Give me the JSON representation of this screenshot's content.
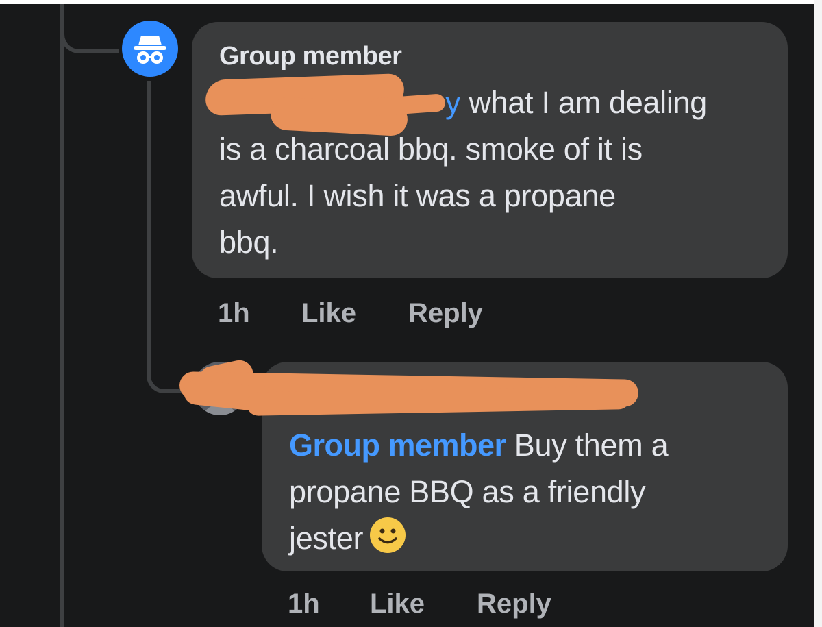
{
  "comment": {
    "author": "Group member",
    "mention_tail": "y ",
    "text_line1": "what I am dealing",
    "text_line2": "is a charcoal bbq. smoke of it is",
    "text_line3": "awful. I wish it was a propane",
    "text_line4": "bbq.",
    "time": "1h",
    "like_label": "Like",
    "reply_label": "Reply"
  },
  "reply": {
    "mention": "Group member",
    "text_line1": " Buy them a",
    "text_line2": "propane BBQ as a friendly",
    "text_line3": "jester",
    "emoji": "slightly-smiling-face",
    "time": "1h",
    "like_label": "Like",
    "reply_label": "Reply"
  },
  "colors": {
    "background": "#18191a",
    "bubble": "#3a3b3c",
    "text": "#e4e6eb",
    "meta": "#b0b3b8",
    "mention": "#4599ff",
    "redaction": "#e8915a",
    "anon_avatar": "#2d88ff"
  },
  "icons": {
    "anonymous_avatar": "incognito-icon",
    "reply_avatar": "profile-photo"
  }
}
